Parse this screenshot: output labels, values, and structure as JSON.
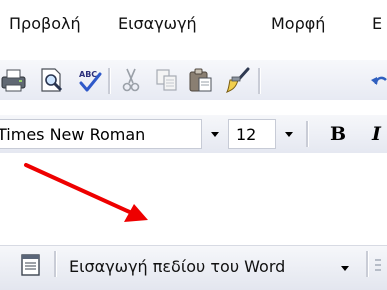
{
  "menu": {
    "items": [
      {
        "label": "Προβολή"
      },
      {
        "label": "Εισαγωγή"
      },
      {
        "label": "Μορφή"
      },
      {
        "label": "Ε"
      }
    ]
  },
  "toolbar_format": {
    "font_name": "Times New Roman",
    "font_size": "12",
    "bold_label": "B",
    "italic_label": "I"
  },
  "toolbar_word": {
    "insert_field_label": "Εισαγωγή πεδίου του Word"
  },
  "colors": {
    "annotation_arrow": "#ee0000",
    "toolbar_top": "#f7f8fb",
    "toolbar_bottom": "#e5e8f1"
  },
  "icons": [
    "print-icon",
    "print-preview-icon",
    "spelling-check-icon",
    "cut-icon",
    "copy-icon",
    "paste-icon",
    "format-painter-icon",
    "undo-icon",
    "document-icon",
    "word-field-icon"
  ]
}
